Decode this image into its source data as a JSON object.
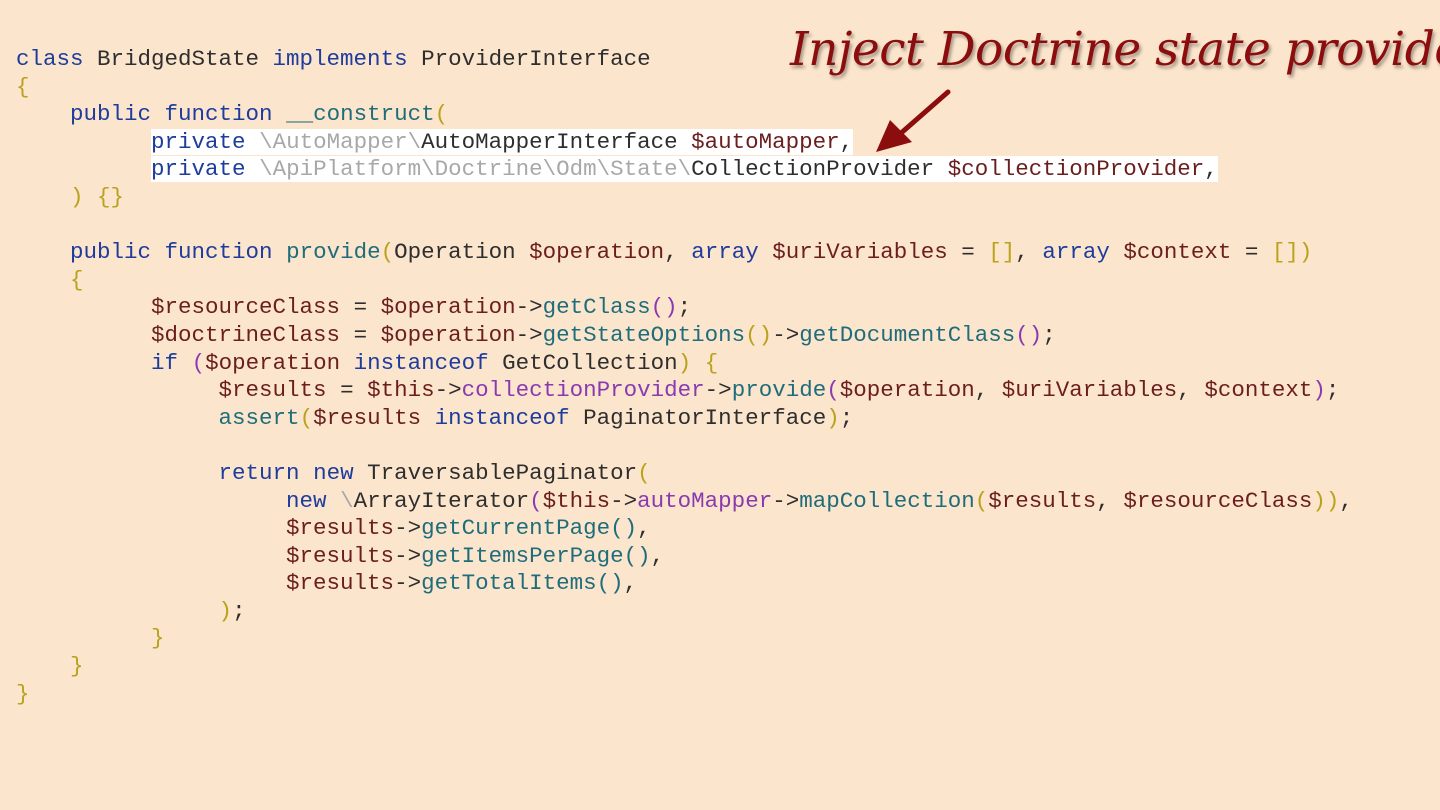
{
  "annotation": {
    "text": "Inject Doctrine state provider"
  },
  "colors": {
    "background": "#fce5cd",
    "default": "#2e2e2e",
    "keyword": "#1e3c9c",
    "method": "#1f6d7a",
    "variable": "#6b1e1e",
    "property": "#8a3ab0",
    "bracket": "#b9a21c",
    "namespace": "#a8a8a8",
    "annotation": "#8b0d0d"
  },
  "code_lines": [
    [
      {
        "t": "class",
        "c": "keyword"
      },
      {
        "t": " BridgedState ",
        "c": "default"
      },
      {
        "t": "implements",
        "c": "keyword"
      },
      {
        "t": " ProviderInterface",
        "c": "default"
      }
    ],
    [
      {
        "t": "{",
        "c": "bracket"
      }
    ],
    [
      {
        "t": "    ",
        "c": "default"
      },
      {
        "t": "public",
        "c": "keyword"
      },
      {
        "t": " ",
        "c": "default"
      },
      {
        "t": "function",
        "c": "keyword"
      },
      {
        "t": " ",
        "c": "default"
      },
      {
        "t": "__construct",
        "c": "method"
      },
      {
        "t": "(",
        "c": "bracket"
      }
    ],
    [
      {
        "t": "          ",
        "c": "default"
      },
      {
        "t": "private",
        "c": "keyword",
        "hl": true
      },
      {
        "t": " ",
        "c": "default",
        "hl": true
      },
      {
        "t": "\\AutoMapper\\",
        "c": "namespace",
        "hl": true
      },
      {
        "t": "AutoMapperInterface ",
        "c": "default",
        "hl": true
      },
      {
        "t": "$autoMapper",
        "c": "variable",
        "hl": true
      },
      {
        "t": ",",
        "c": "default",
        "hl": true
      }
    ],
    [
      {
        "t": "          ",
        "c": "default"
      },
      {
        "t": "private",
        "c": "keyword",
        "hl": true
      },
      {
        "t": " ",
        "c": "default",
        "hl": true
      },
      {
        "t": "\\ApiPlatform\\Doctrine\\Odm\\State\\",
        "c": "namespace",
        "hl": true
      },
      {
        "t": "CollectionProvider ",
        "c": "default",
        "hl": true
      },
      {
        "t": "$collectionProvider",
        "c": "variable",
        "hl": true
      },
      {
        "t": ",",
        "c": "default",
        "hl": true
      }
    ],
    [
      {
        "t": "    ",
        "c": "default"
      },
      {
        "t": ") {}",
        "c": "bracket"
      }
    ],
    [],
    [
      {
        "t": "    ",
        "c": "default"
      },
      {
        "t": "public",
        "c": "keyword"
      },
      {
        "t": " ",
        "c": "default"
      },
      {
        "t": "function",
        "c": "keyword"
      },
      {
        "t": " ",
        "c": "default"
      },
      {
        "t": "provide",
        "c": "method"
      },
      {
        "t": "(",
        "c": "bracket"
      },
      {
        "t": "Operation ",
        "c": "default"
      },
      {
        "t": "$operation",
        "c": "variable"
      },
      {
        "t": ", ",
        "c": "default"
      },
      {
        "t": "array",
        "c": "keyword"
      },
      {
        "t": " ",
        "c": "default"
      },
      {
        "t": "$uriVariables",
        "c": "variable"
      },
      {
        "t": " = ",
        "c": "default"
      },
      {
        "t": "[]",
        "c": "bracket"
      },
      {
        "t": ", ",
        "c": "default"
      },
      {
        "t": "array",
        "c": "keyword"
      },
      {
        "t": " ",
        "c": "default"
      },
      {
        "t": "$context",
        "c": "variable"
      },
      {
        "t": " = ",
        "c": "default"
      },
      {
        "t": "[])",
        "c": "bracket"
      }
    ],
    [
      {
        "t": "    ",
        "c": "default"
      },
      {
        "t": "{",
        "c": "bracket"
      }
    ],
    [
      {
        "t": "          ",
        "c": "default"
      },
      {
        "t": "$resourceClass",
        "c": "variable"
      },
      {
        "t": " = ",
        "c": "default"
      },
      {
        "t": "$operation",
        "c": "variable"
      },
      {
        "t": "->",
        "c": "default"
      },
      {
        "t": "getClass",
        "c": "method"
      },
      {
        "t": "()",
        "c": "property"
      },
      {
        "t": ";",
        "c": "default"
      }
    ],
    [
      {
        "t": "          ",
        "c": "default"
      },
      {
        "t": "$doctrineClass",
        "c": "variable"
      },
      {
        "t": " = ",
        "c": "default"
      },
      {
        "t": "$operation",
        "c": "variable"
      },
      {
        "t": "->",
        "c": "default"
      },
      {
        "t": "getStateOptions",
        "c": "method"
      },
      {
        "t": "()",
        "c": "bracket"
      },
      {
        "t": "->",
        "c": "default"
      },
      {
        "t": "getDocumentClass",
        "c": "method"
      },
      {
        "t": "()",
        "c": "property"
      },
      {
        "t": ";",
        "c": "default"
      }
    ],
    [
      {
        "t": "          ",
        "c": "default"
      },
      {
        "t": "if",
        "c": "keyword"
      },
      {
        "t": " ",
        "c": "default"
      },
      {
        "t": "(",
        "c": "property"
      },
      {
        "t": "$operation",
        "c": "variable"
      },
      {
        "t": " ",
        "c": "default"
      },
      {
        "t": "instanceof",
        "c": "keyword"
      },
      {
        "t": " GetCollection",
        "c": "default"
      },
      {
        "t": ") {",
        "c": "bracket"
      }
    ],
    [
      {
        "t": "               ",
        "c": "default"
      },
      {
        "t": "$results",
        "c": "variable"
      },
      {
        "t": " = ",
        "c": "default"
      },
      {
        "t": "$this",
        "c": "variable"
      },
      {
        "t": "->",
        "c": "default"
      },
      {
        "t": "collectionProvider",
        "c": "property"
      },
      {
        "t": "->",
        "c": "default"
      },
      {
        "t": "provide",
        "c": "method"
      },
      {
        "t": "(",
        "c": "property"
      },
      {
        "t": "$operation",
        "c": "variable"
      },
      {
        "t": ", ",
        "c": "default"
      },
      {
        "t": "$uriVariables",
        "c": "variable"
      },
      {
        "t": ", ",
        "c": "default"
      },
      {
        "t": "$context",
        "c": "variable"
      },
      {
        "t": ")",
        "c": "property"
      },
      {
        "t": ";",
        "c": "default"
      }
    ],
    [
      {
        "t": "               ",
        "c": "default"
      },
      {
        "t": "assert",
        "c": "method"
      },
      {
        "t": "(",
        "c": "bracket"
      },
      {
        "t": "$results",
        "c": "variable"
      },
      {
        "t": " ",
        "c": "default"
      },
      {
        "t": "instanceof",
        "c": "keyword"
      },
      {
        "t": " PaginatorInterface",
        "c": "default"
      },
      {
        "t": ")",
        "c": "bracket"
      },
      {
        "t": ";",
        "c": "default"
      }
    ],
    [],
    [
      {
        "t": "               ",
        "c": "default"
      },
      {
        "t": "return",
        "c": "keyword"
      },
      {
        "t": " ",
        "c": "default"
      },
      {
        "t": "new",
        "c": "keyword"
      },
      {
        "t": " TraversablePaginator",
        "c": "default"
      },
      {
        "t": "(",
        "c": "bracket"
      }
    ],
    [
      {
        "t": "                    ",
        "c": "default"
      },
      {
        "t": "new",
        "c": "keyword"
      },
      {
        "t": " ",
        "c": "default"
      },
      {
        "t": "\\",
        "c": "namespace"
      },
      {
        "t": "ArrayIterator",
        "c": "default"
      },
      {
        "t": "(",
        "c": "property"
      },
      {
        "t": "$this",
        "c": "variable"
      },
      {
        "t": "->",
        "c": "default"
      },
      {
        "t": "autoMapper",
        "c": "property"
      },
      {
        "t": "->",
        "c": "default"
      },
      {
        "t": "mapCollection",
        "c": "method"
      },
      {
        "t": "(",
        "c": "bracket"
      },
      {
        "t": "$results",
        "c": "variable"
      },
      {
        "t": ", ",
        "c": "default"
      },
      {
        "t": "$resourceClass",
        "c": "variable"
      },
      {
        "t": "))",
        "c": "bracket"
      },
      {
        "t": ",",
        "c": "default"
      }
    ],
    [
      {
        "t": "                    ",
        "c": "default"
      },
      {
        "t": "$results",
        "c": "variable"
      },
      {
        "t": "->",
        "c": "default"
      },
      {
        "t": "getCurrentPage",
        "c": "method"
      },
      {
        "t": "()",
        "c": "method"
      },
      {
        "t": ",",
        "c": "default"
      }
    ],
    [
      {
        "t": "                    ",
        "c": "default"
      },
      {
        "t": "$results",
        "c": "variable"
      },
      {
        "t": "->",
        "c": "default"
      },
      {
        "t": "getItemsPerPage",
        "c": "method"
      },
      {
        "t": "()",
        "c": "method"
      },
      {
        "t": ",",
        "c": "default"
      }
    ],
    [
      {
        "t": "                    ",
        "c": "default"
      },
      {
        "t": "$results",
        "c": "variable"
      },
      {
        "t": "->",
        "c": "default"
      },
      {
        "t": "getTotalItems",
        "c": "method"
      },
      {
        "t": "()",
        "c": "method"
      },
      {
        "t": ",",
        "c": "default"
      }
    ],
    [
      {
        "t": "               ",
        "c": "default"
      },
      {
        "t": ")",
        "c": "bracket"
      },
      {
        "t": ";",
        "c": "default"
      }
    ],
    [
      {
        "t": "          ",
        "c": "default"
      },
      {
        "t": "}",
        "c": "bracket"
      }
    ],
    [
      {
        "t": "    ",
        "c": "default"
      },
      {
        "t": "}",
        "c": "bracket"
      }
    ],
    [
      {
        "t": "}",
        "c": "bracket"
      }
    ]
  ]
}
